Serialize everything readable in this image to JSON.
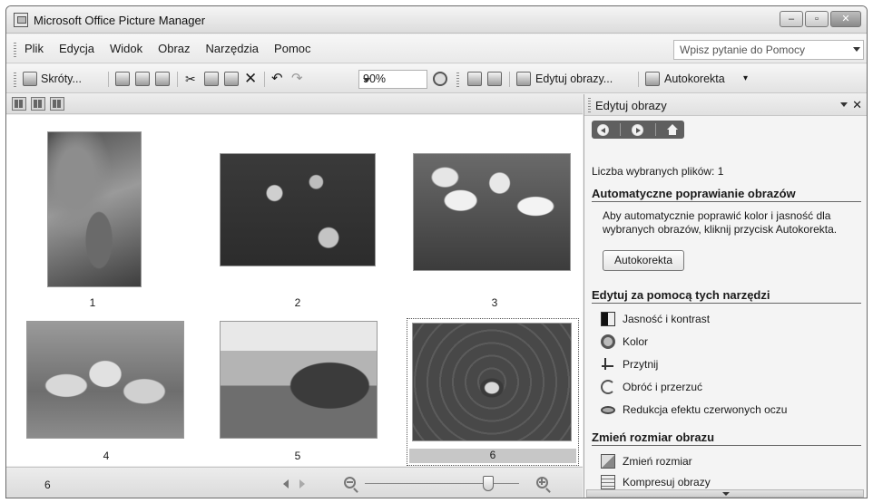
{
  "window": {
    "title": "Microsoft Office Picture Manager",
    "controls": {
      "minimize": "–",
      "maximize": "▫",
      "close": "✕"
    }
  },
  "menu": {
    "items": [
      "Plik",
      "Edycja",
      "Widok",
      "Obraz",
      "Narzędzia",
      "Pomoc"
    ],
    "help_placeholder": "Wpisz pytanie do Pomocy"
  },
  "toolbar": {
    "shortcuts_label": "Skróty...",
    "zoom_value": "90%",
    "edit_images_label": "Edytuj obrazy...",
    "autocorrect_label": "Autokorekta"
  },
  "thumbnails": [
    {
      "number": "1"
    },
    {
      "number": "2"
    },
    {
      "number": "3"
    },
    {
      "number": "4"
    },
    {
      "number": "5"
    },
    {
      "number": "6",
      "selected": true
    }
  ],
  "status": {
    "count": "6",
    "zoom_slider_level": 0.8
  },
  "pane": {
    "title": "Edytuj obrazy",
    "selected_files": "Liczba wybranych plików: 1",
    "auto_section": "Automatyczne poprawianie obrazów",
    "auto_description": "Aby automatycznie poprawić kolor i jasność dla wybranych obrazów, kliknij przycisk Autokorekta.",
    "auto_button": "Autokorekta",
    "tools_section": "Edytuj za pomocą tych narzędzi",
    "tools": [
      {
        "label": "Jasność i kontrast",
        "icon": "brightness-contrast-icon"
      },
      {
        "label": "Kolor",
        "icon": "color-icon"
      },
      {
        "label": "Przytnij",
        "icon": "crop-icon"
      },
      {
        "label": "Obróć i przerzuć",
        "icon": "rotate-flip-icon"
      },
      {
        "label": "Redukcja efektu czerwonych oczu",
        "icon": "red-eye-icon"
      }
    ],
    "resize_section": "Zmień rozmiar obrazu",
    "resize_tools": [
      {
        "label": "Zmień rozmiar",
        "icon": "resize-icon"
      },
      {
        "label": "Kompresuj obrazy",
        "icon": "compress-icon"
      }
    ]
  }
}
